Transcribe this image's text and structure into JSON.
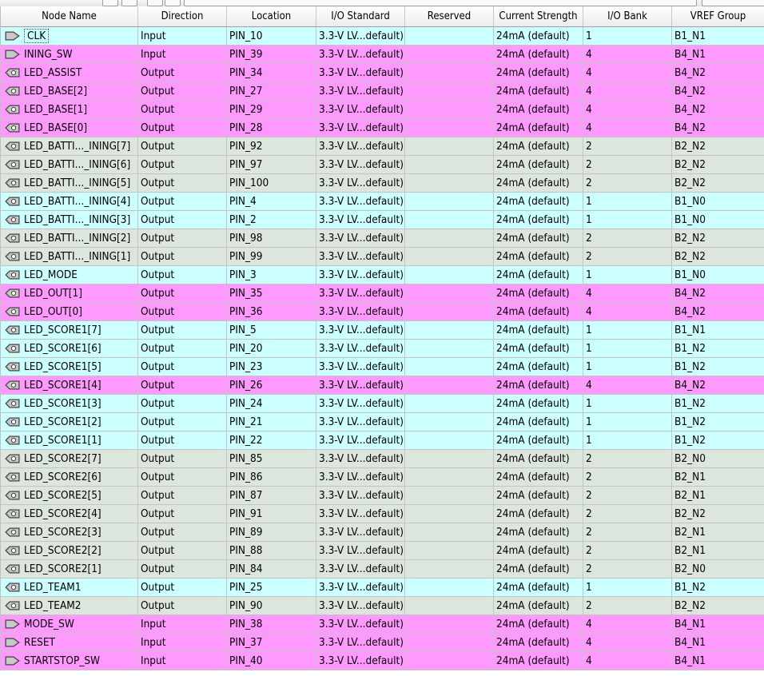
{
  "columns": [
    "Node Name",
    "Direction",
    "Location",
    "I/O Standard",
    "Reserved",
    "Current Strength",
    "I/O Bank",
    "VREF Group"
  ],
  "row_colors": {
    "cyan": "#ccffff",
    "magenta": "#ff99ff",
    "gray": "#dde6dd"
  },
  "icons": {
    "input": "input-pin-icon",
    "output": "output-pin-icon"
  },
  "rows": [
    {
      "name": "CLK",
      "direction": "Input",
      "location": "PIN_10",
      "io_standard": "3.3-V LV...default)",
      "reserved": "",
      "current_strength": "24mA (default)",
      "io_bank": "1",
      "vref_group": "B1_N1",
      "color": "cyan"
    },
    {
      "name": "INING_SW",
      "direction": "Input",
      "location": "PIN_39",
      "io_standard": "3.3-V LV...default)",
      "reserved": "",
      "current_strength": "24mA (default)",
      "io_bank": "4",
      "vref_group": "B4_N1",
      "color": "magenta"
    },
    {
      "name": "LED_ASSIST",
      "direction": "Output",
      "location": "PIN_34",
      "io_standard": "3.3-V LV...default)",
      "reserved": "",
      "current_strength": "24mA (default)",
      "io_bank": "4",
      "vref_group": "B4_N2",
      "color": "magenta"
    },
    {
      "name": "LED_BASE[2]",
      "direction": "Output",
      "location": "PIN_27",
      "io_standard": "3.3-V LV...default)",
      "reserved": "",
      "current_strength": "24mA (default)",
      "io_bank": "4",
      "vref_group": "B4_N2",
      "color": "magenta"
    },
    {
      "name": "LED_BASE[1]",
      "direction": "Output",
      "location": "PIN_29",
      "io_standard": "3.3-V LV...default)",
      "reserved": "",
      "current_strength": "24mA (default)",
      "io_bank": "4",
      "vref_group": "B4_N2",
      "color": "magenta"
    },
    {
      "name": "LED_BASE[0]",
      "direction": "Output",
      "location": "PIN_28",
      "io_standard": "3.3-V LV...default)",
      "reserved": "",
      "current_strength": "24mA (default)",
      "io_bank": "4",
      "vref_group": "B4_N2",
      "color": "magenta"
    },
    {
      "name": "LED_BATTI..._INING[7]",
      "direction": "Output",
      "location": "PIN_92",
      "io_standard": "3.3-V LV...default)",
      "reserved": "",
      "current_strength": "24mA (default)",
      "io_bank": "2",
      "vref_group": "B2_N2",
      "color": "gray"
    },
    {
      "name": "LED_BATTI..._INING[6]",
      "direction": "Output",
      "location": "PIN_97",
      "io_standard": "3.3-V LV...default)",
      "reserved": "",
      "current_strength": "24mA (default)",
      "io_bank": "2",
      "vref_group": "B2_N2",
      "color": "gray"
    },
    {
      "name": "LED_BATTI..._INING[5]",
      "direction": "Output",
      "location": "PIN_100",
      "io_standard": "3.3-V LV...default)",
      "reserved": "",
      "current_strength": "24mA (default)",
      "io_bank": "2",
      "vref_group": "B2_N2",
      "color": "gray"
    },
    {
      "name": "LED_BATTI..._INING[4]",
      "direction": "Output",
      "location": "PIN_4",
      "io_standard": "3.3-V LV...default)",
      "reserved": "",
      "current_strength": "24mA (default)",
      "io_bank": "1",
      "vref_group": "B1_N0",
      "color": "cyan"
    },
    {
      "name": "LED_BATTI..._INING[3]",
      "direction": "Output",
      "location": "PIN_2",
      "io_standard": "3.3-V LV...default)",
      "reserved": "",
      "current_strength": "24mA (default)",
      "io_bank": "1",
      "vref_group": "B1_N0",
      "color": "cyan"
    },
    {
      "name": "LED_BATTI..._INING[2]",
      "direction": "Output",
      "location": "PIN_98",
      "io_standard": "3.3-V LV...default)",
      "reserved": "",
      "current_strength": "24mA (default)",
      "io_bank": "2",
      "vref_group": "B2_N2",
      "color": "gray"
    },
    {
      "name": "LED_BATTI..._INING[1]",
      "direction": "Output",
      "location": "PIN_99",
      "io_standard": "3.3-V LV...default)",
      "reserved": "",
      "current_strength": "24mA (default)",
      "io_bank": "2",
      "vref_group": "B2_N2",
      "color": "gray"
    },
    {
      "name": "LED_MODE",
      "direction": "Output",
      "location": "PIN_3",
      "io_standard": "3.3-V LV...default)",
      "reserved": "",
      "current_strength": "24mA (default)",
      "io_bank": "1",
      "vref_group": "B1_N0",
      "color": "cyan"
    },
    {
      "name": "LED_OUT[1]",
      "direction": "Output",
      "location": "PIN_35",
      "io_standard": "3.3-V LV...default)",
      "reserved": "",
      "current_strength": "24mA (default)",
      "io_bank": "4",
      "vref_group": "B4_N2",
      "color": "magenta"
    },
    {
      "name": "LED_OUT[0]",
      "direction": "Output",
      "location": "PIN_36",
      "io_standard": "3.3-V LV...default)",
      "reserved": "",
      "current_strength": "24mA (default)",
      "io_bank": "4",
      "vref_group": "B4_N2",
      "color": "magenta"
    },
    {
      "name": "LED_SCORE1[7]",
      "direction": "Output",
      "location": "PIN_5",
      "io_standard": "3.3-V LV...default)",
      "reserved": "",
      "current_strength": "24mA (default)",
      "io_bank": "1",
      "vref_group": "B1_N1",
      "color": "cyan"
    },
    {
      "name": "LED_SCORE1[6]",
      "direction": "Output",
      "location": "PIN_20",
      "io_standard": "3.3-V LV...default)",
      "reserved": "",
      "current_strength": "24mA (default)",
      "io_bank": "1",
      "vref_group": "B1_N2",
      "color": "cyan"
    },
    {
      "name": "LED_SCORE1[5]",
      "direction": "Output",
      "location": "PIN_23",
      "io_standard": "3.3-V LV...default)",
      "reserved": "",
      "current_strength": "24mA (default)",
      "io_bank": "1",
      "vref_group": "B1_N2",
      "color": "cyan"
    },
    {
      "name": "LED_SCORE1[4]",
      "direction": "Output",
      "location": "PIN_26",
      "io_standard": "3.3-V LV...default)",
      "reserved": "",
      "current_strength": "24mA (default)",
      "io_bank": "4",
      "vref_group": "B4_N2",
      "color": "magenta"
    },
    {
      "name": "LED_SCORE1[3]",
      "direction": "Output",
      "location": "PIN_24",
      "io_standard": "3.3-V LV...default)",
      "reserved": "",
      "current_strength": "24mA (default)",
      "io_bank": "1",
      "vref_group": "B1_N2",
      "color": "cyan"
    },
    {
      "name": "LED_SCORE1[2]",
      "direction": "Output",
      "location": "PIN_21",
      "io_standard": "3.3-V LV...default)",
      "reserved": "",
      "current_strength": "24mA (default)",
      "io_bank": "1",
      "vref_group": "B1_N2",
      "color": "cyan"
    },
    {
      "name": "LED_SCORE1[1]",
      "direction": "Output",
      "location": "PIN_22",
      "io_standard": "3.3-V LV...default)",
      "reserved": "",
      "current_strength": "24mA (default)",
      "io_bank": "1",
      "vref_group": "B1_N2",
      "color": "cyan"
    },
    {
      "name": "LED_SCORE2[7]",
      "direction": "Output",
      "location": "PIN_85",
      "io_standard": "3.3-V LV...default)",
      "reserved": "",
      "current_strength": "24mA (default)",
      "io_bank": "2",
      "vref_group": "B2_N0",
      "color": "gray"
    },
    {
      "name": "LED_SCORE2[6]",
      "direction": "Output",
      "location": "PIN_86",
      "io_standard": "3.3-V LV...default)",
      "reserved": "",
      "current_strength": "24mA (default)",
      "io_bank": "2",
      "vref_group": "B2_N1",
      "color": "gray"
    },
    {
      "name": "LED_SCORE2[5]",
      "direction": "Output",
      "location": "PIN_87",
      "io_standard": "3.3-V LV...default)",
      "reserved": "",
      "current_strength": "24mA (default)",
      "io_bank": "2",
      "vref_group": "B2_N1",
      "color": "gray"
    },
    {
      "name": "LED_SCORE2[4]",
      "direction": "Output",
      "location": "PIN_91",
      "io_standard": "3.3-V LV...default)",
      "reserved": "",
      "current_strength": "24mA (default)",
      "io_bank": "2",
      "vref_group": "B2_N2",
      "color": "gray"
    },
    {
      "name": "LED_SCORE2[3]",
      "direction": "Output",
      "location": "PIN_89",
      "io_standard": "3.3-V LV...default)",
      "reserved": "",
      "current_strength": "24mA (default)",
      "io_bank": "2",
      "vref_group": "B2_N1",
      "color": "gray"
    },
    {
      "name": "LED_SCORE2[2]",
      "direction": "Output",
      "location": "PIN_88",
      "io_standard": "3.3-V LV...default)",
      "reserved": "",
      "current_strength": "24mA (default)",
      "io_bank": "2",
      "vref_group": "B2_N1",
      "color": "gray"
    },
    {
      "name": "LED_SCORE2[1]",
      "direction": "Output",
      "location": "PIN_84",
      "io_standard": "3.3-V LV...default)",
      "reserved": "",
      "current_strength": "24mA (default)",
      "io_bank": "2",
      "vref_group": "B2_N0",
      "color": "gray"
    },
    {
      "name": "LED_TEAM1",
      "direction": "Output",
      "location": "PIN_25",
      "io_standard": "3.3-V LV...default)",
      "reserved": "",
      "current_strength": "24mA (default)",
      "io_bank": "1",
      "vref_group": "B1_N2",
      "color": "cyan"
    },
    {
      "name": "LED_TEAM2",
      "direction": "Output",
      "location": "PIN_90",
      "io_standard": "3.3-V LV...default)",
      "reserved": "",
      "current_strength": "24mA (default)",
      "io_bank": "2",
      "vref_group": "B2_N2",
      "color": "gray"
    },
    {
      "name": "MODE_SW",
      "direction": "Input",
      "location": "PIN_38",
      "io_standard": "3.3-V LV...default)",
      "reserved": "",
      "current_strength": "24mA (default)",
      "io_bank": "4",
      "vref_group": "B4_N1",
      "color": "magenta"
    },
    {
      "name": "RESET",
      "direction": "Input",
      "location": "PIN_37",
      "io_standard": "3.3-V LV...default)",
      "reserved": "",
      "current_strength": "24mA (default)",
      "io_bank": "4",
      "vref_group": "B4_N1",
      "color": "magenta"
    },
    {
      "name": "STARTSTOP_SW",
      "direction": "Input",
      "location": "PIN_40",
      "io_standard": "3.3-V LV...default)",
      "reserved": "",
      "current_strength": "24mA (default)",
      "io_bank": "4",
      "vref_group": "B4_N1",
      "color": "magenta"
    }
  ]
}
